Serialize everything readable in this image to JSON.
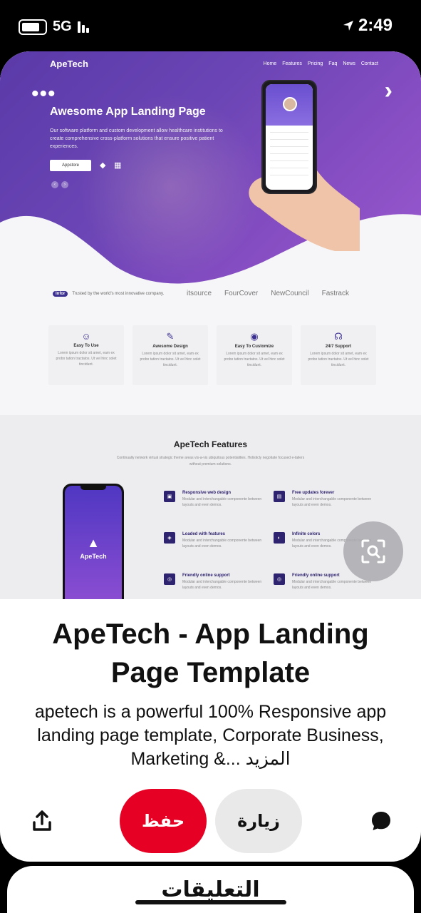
{
  "status": {
    "network": "5G",
    "time": "2:49"
  },
  "hero": {
    "brand": "ApeTech",
    "nav": [
      "Home",
      "Features",
      "Pricing",
      "Faq",
      "News",
      "Contact"
    ],
    "title": "Awesome App Landing Page",
    "description": "Our software platform and custom development allow healthcare institutions to create comprehensive cross-platform solutions that ensure positive patient experiences.",
    "store_button": "Appstore",
    "trusted_badge": "Infor",
    "trusted_text": "Trusted by the world's most innovative company.",
    "partner_logos": [
      "itsource",
      "FourCover",
      "NewCouncil",
      "Fastrack"
    ],
    "features": [
      {
        "title": "Easy To Use",
        "desc": "Lorem ipsum dolor sit amet, eam ex probo tation tractatos. Ut vel hinc solet tincidunt."
      },
      {
        "title": "Awesome Design",
        "desc": "Lorem ipsum dolor sit amet, eam ex probo tation tractatos. Ut vel hinc solet tincidunt."
      },
      {
        "title": "Easy To Customize",
        "desc": "Lorem ipsum dolor sit amet, eam ex probo tation tractatos. Ut vel hinc solet tincidunt."
      },
      {
        "title": "24/7 Support",
        "desc": "Lorem ipsum dolor sit amet, eam ex probo tation tractatos. Ut vel hinc solet tincidunt."
      }
    ],
    "features_heading": "ApeTech Features",
    "features_sub": "Continually network virtual strategic theme areas vis-a-vis ubiquitous potentialities. Holisticly negotiate focused e-tailers without premium solutions.",
    "phone_brand": "ApeTech",
    "feature_list": [
      {
        "title": "Responsive web design",
        "desc": "Modular and interchangable componente between layouts and even demos."
      },
      {
        "title": "Free updates forever",
        "desc": "Modular and interchangable componente between layouts and even demos."
      },
      {
        "title": "Loaded with features",
        "desc": "Modular and interchangable componente between layouts and even demos."
      },
      {
        "title": "Infinite colors",
        "desc": "Modular and interchangable componente between layouts and even demos."
      },
      {
        "title": "Friendly online support",
        "desc": "Modular and interchangable componente between layouts and even demos."
      },
      {
        "title": "Friendly online support",
        "desc": "Modular and interchangable componente between layouts and even demos."
      }
    ]
  },
  "pin": {
    "title": "ApeTech - App Landing Page Template",
    "description": "apetech is a powerful 100% Responsive app landing page template, Corporate Business, Marketing &... المزيد"
  },
  "actions": {
    "save": "حفظ",
    "visit": "زيارة"
  },
  "comments": {
    "title": "التعليقات"
  },
  "colors": {
    "save_red": "#e60023",
    "hero_purple": "#6b45b5"
  }
}
